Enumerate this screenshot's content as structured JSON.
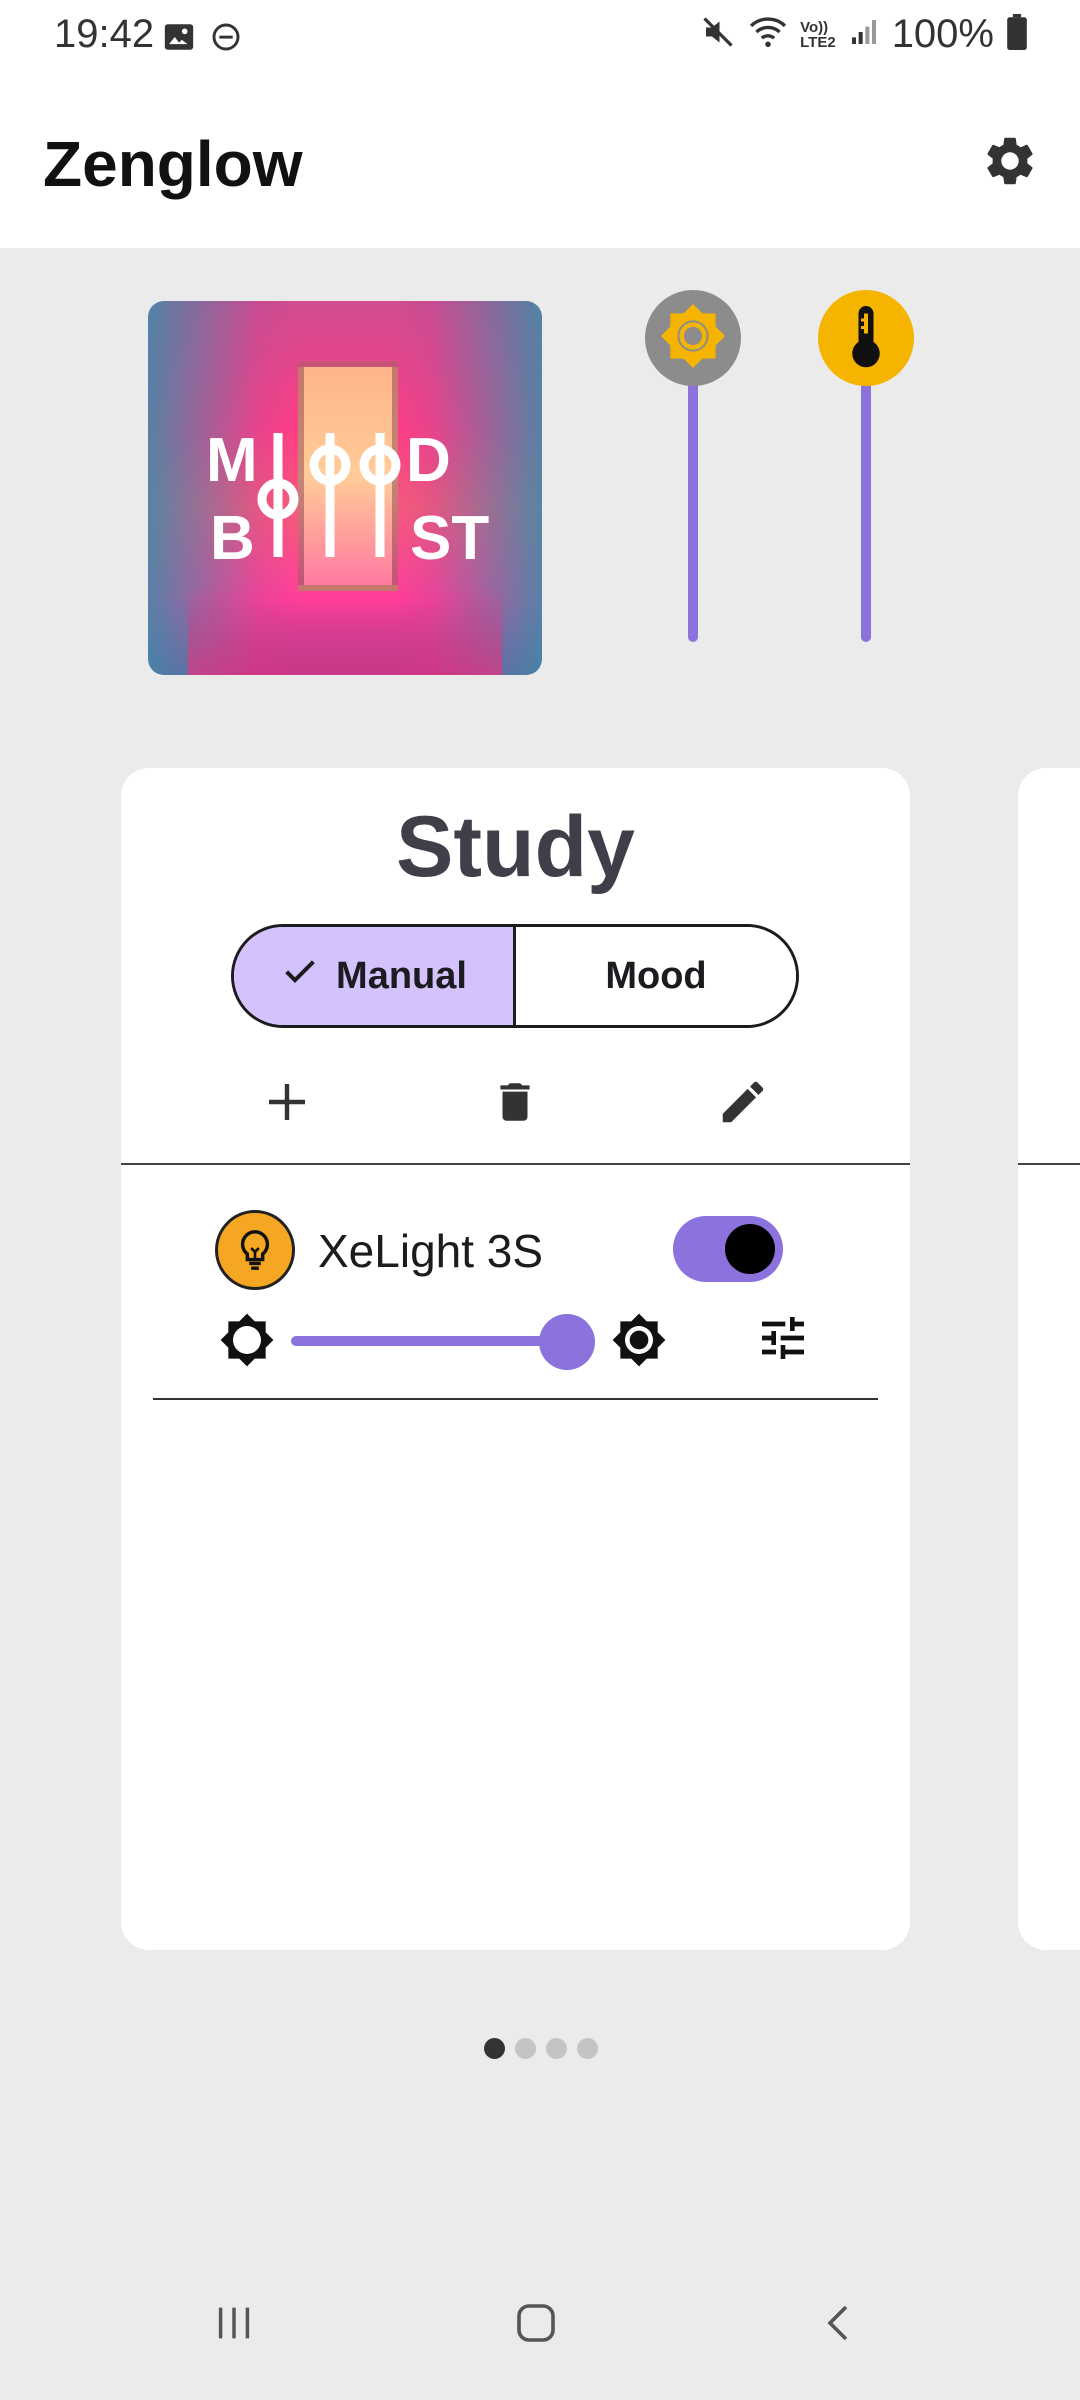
{
  "status_bar": {
    "time": "19:42",
    "battery": "100%",
    "left_icons": [
      "image-icon",
      "do-not-disturb-icon"
    ],
    "right_icons": [
      "mute-icon",
      "wifi-icon",
      "volte-icon",
      "signal-icon",
      "battery-icon"
    ],
    "volte_label_top": "Vo))",
    "volte_label_bottom": "LTE2"
  },
  "app_bar": {
    "title": "Zenglow",
    "settings_icon": "gear-icon"
  },
  "mood_image": {
    "logo_line1_left": "M",
    "logo_line1_right": "D",
    "logo_line2_left": "B",
    "logo_line2_right": "ST"
  },
  "sliders": {
    "brightness_icon": "brightness-icon",
    "temperature_icon": "thermometer-icon"
  },
  "room_card": {
    "title": "Study",
    "modes": [
      {
        "label": "Manual",
        "selected": true
      },
      {
        "label": "Mood",
        "selected": false
      }
    ],
    "actions": [
      "add-icon",
      "delete-icon",
      "edit-icon"
    ],
    "devices": [
      {
        "name": "XeLight 3S",
        "on": true,
        "brightness": 1.0
      }
    ]
  },
  "pager": {
    "total": 4,
    "active": 1
  },
  "nav_bar": {
    "buttons": [
      "recents-icon",
      "home-icon",
      "back-icon"
    ]
  },
  "colors": {
    "accent": "#8b72dd",
    "selected_mode": "#d3c2fb",
    "amber": "#f5b400",
    "background": "#ebebeb"
  }
}
